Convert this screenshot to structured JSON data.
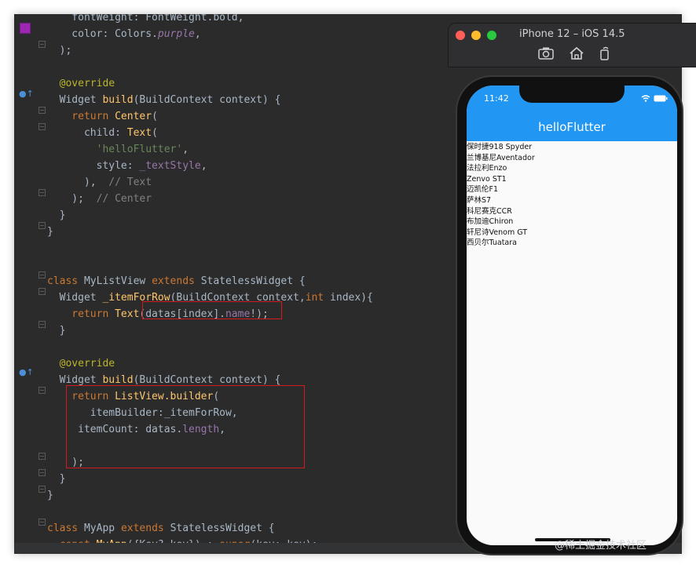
{
  "simulator": {
    "title": "iPhone 12 – iOS 14.5",
    "toolbar_icons": [
      "camera-icon",
      "home-icon",
      "rotate-icon"
    ],
    "traffic_colors": {
      "close": "#ff5f57",
      "minimize": "#febc2e",
      "maximize": "#28c840"
    }
  },
  "phone": {
    "status_time": "11:42",
    "app_title": "helloFlutter",
    "app_bar_color": "#2196f3",
    "list_items": [
      "保时捷918 Spyder",
      "兰博基尼Aventador",
      "法拉利Enzo",
      "Zenvo ST1",
      "迈凯伦F1",
      "萨林S7",
      "科尼赛克CCR",
      "布加迪Chiron",
      "轩尼诗Venom GT",
      "西贝尔Tuatara"
    ]
  },
  "editor": {
    "lines": [
      [
        [
          "t-text",
          "    fontWeight: FontWeight.bold,"
        ]
      ],
      [
        [
          "t-text",
          "    color: Colors."
        ],
        [
          "t-purple",
          "purple"
        ],
        [
          "t-text",
          ","
        ]
      ],
      [
        [
          "t-text",
          "  );"
        ]
      ],
      [],
      [
        [
          "t-anno",
          "  @override"
        ]
      ],
      [
        [
          "t-text",
          "  Widget "
        ],
        [
          "t-fn",
          "build"
        ],
        [
          "t-text",
          "(BuildContext context) {"
        ]
      ],
      [
        [
          "t-kw",
          "    return "
        ],
        [
          "t-fn",
          "Center"
        ],
        [
          "t-text",
          "("
        ]
      ],
      [
        [
          "t-text",
          "      child: "
        ],
        [
          "t-fn",
          "Text"
        ],
        [
          "t-text",
          "("
        ]
      ],
      [
        [
          "t-str",
          "        'helloFlutter'"
        ],
        [
          "t-text",
          ","
        ]
      ],
      [
        [
          "t-text",
          "        style: "
        ],
        [
          "t-field",
          "_textStyle"
        ],
        [
          "t-text",
          ","
        ]
      ],
      [
        [
          "t-text",
          "      ),  "
        ],
        [
          "t-comment",
          "// Text"
        ]
      ],
      [
        [
          "t-text",
          "    );  "
        ],
        [
          "t-comment",
          "// Center"
        ]
      ],
      [
        [
          "t-text",
          "  }"
        ]
      ],
      [
        [
          "t-text",
          "}"
        ]
      ],
      [],
      [],
      [
        [
          "t-kw",
          "class "
        ],
        [
          "t-type",
          "MyListView "
        ],
        [
          "t-kw",
          "extends "
        ],
        [
          "t-text",
          "StatelessWidget {"
        ]
      ],
      [
        [
          "t-text",
          "  Widget "
        ],
        [
          "t-fn",
          "_itemForRow"
        ],
        [
          "t-text",
          "(BuildContext context,"
        ],
        [
          "t-kw",
          "int "
        ],
        [
          "t-text",
          "index){"
        ]
      ],
      [
        [
          "t-kw",
          "    return "
        ],
        [
          "t-fn",
          "Text"
        ],
        [
          "t-text",
          "(datas[index]."
        ],
        [
          "t-field",
          "name"
        ],
        [
          "t-text",
          "!);"
        ]
      ],
      [
        [
          "t-text",
          "  }"
        ]
      ],
      [],
      [
        [
          "t-anno",
          "  @override"
        ]
      ],
      [
        [
          "t-text",
          "  Widget "
        ],
        [
          "t-fn",
          "build"
        ],
        [
          "t-text",
          "(BuildContext context) {"
        ]
      ],
      [
        [
          "t-kw",
          "    return "
        ],
        [
          "t-fn",
          "ListView.builder"
        ],
        [
          "t-text",
          "("
        ]
      ],
      [
        [
          "t-text",
          "       itemBuilder:_itemForRow,"
        ]
      ],
      [
        [
          "t-text",
          "     itemCount: datas."
        ],
        [
          "t-field",
          "length"
        ],
        [
          "t-text",
          ","
        ]
      ],
      [],
      [
        [
          "t-text",
          "    );"
        ]
      ],
      [
        [
          "t-text",
          "  }"
        ]
      ],
      [
        [
          "t-text",
          "}"
        ]
      ],
      [],
      [
        [
          "t-kw",
          "class "
        ],
        [
          "t-type",
          "MyApp "
        ],
        [
          "t-kw",
          "extends "
        ],
        [
          "t-text",
          "StatelessWidget {"
        ]
      ],
      [
        [
          "t-kw",
          "  const "
        ],
        [
          "t-fn",
          "MyApp"
        ],
        [
          "t-text",
          "({Key? key}) : "
        ],
        [
          "t-kw",
          "super"
        ],
        [
          "t-text",
          "(key: key);"
        ]
      ]
    ]
  },
  "watermark": "@稀土掘金技术社区"
}
